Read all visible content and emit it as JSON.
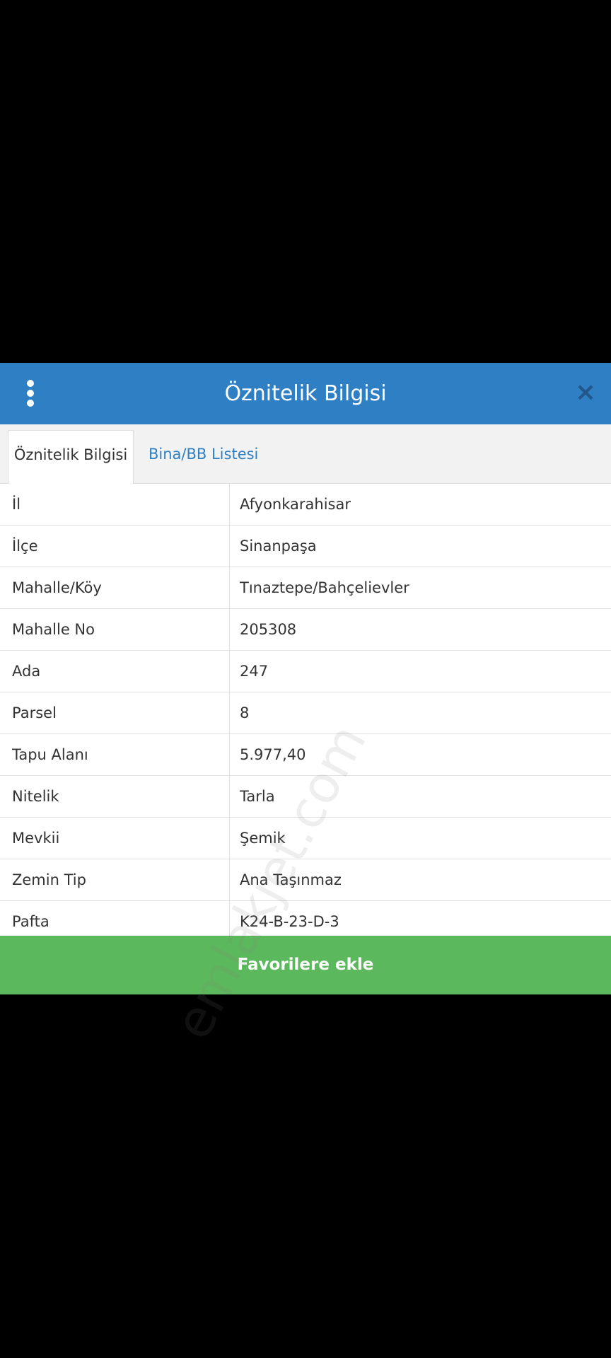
{
  "header": {
    "title": "Öznitelik Bilgisi",
    "menu_icon": "more-vertical-icon",
    "close_icon": "close-icon",
    "close_glyph": "×"
  },
  "tabs": [
    {
      "label": "Öznitelik Bilgisi",
      "active": true
    },
    {
      "label": "Bina/BB Listesi",
      "active": false
    }
  ],
  "attributes": [
    {
      "key": "İl",
      "value": "Afyonkarahisar"
    },
    {
      "key": "İlçe",
      "value": "Sinanpaşa"
    },
    {
      "key": "Mahalle/Köy",
      "value": "Tınaztepe/Bahçelievler"
    },
    {
      "key": "Mahalle No",
      "value": "205308"
    },
    {
      "key": "Ada",
      "value": "247"
    },
    {
      "key": "Parsel",
      "value": "8"
    },
    {
      "key": "Tapu Alanı",
      "value": "5.977,40"
    },
    {
      "key": "Nitelik",
      "value": "Tarla"
    },
    {
      "key": "Mevkii",
      "value": "Şemik"
    },
    {
      "key": "Zemin Tip",
      "value": "Ana Taşınmaz"
    },
    {
      "key": "Pafta",
      "value": "K24-B-23-D-3"
    }
  ],
  "action": {
    "favorite_label": "Favorilere ekle"
  },
  "watermark": "emlakjet.com",
  "colors": {
    "header": "#2f7fc4",
    "tab_link": "#2f7fc4",
    "favorite_button": "#5cb85c",
    "background": "#000000"
  }
}
